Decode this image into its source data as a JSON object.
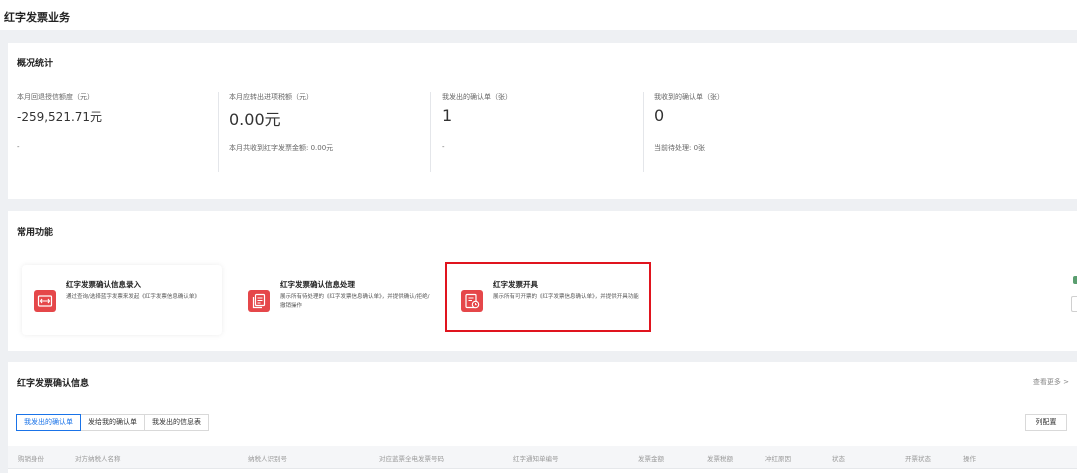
{
  "page": {
    "title": "红字发票业务"
  },
  "overview": {
    "title": "概况统计",
    "stats": [
      {
        "label": "本月回退授信额度（元）",
        "value": "-259,521.71元",
        "sub": "-"
      },
      {
        "label": "本月应转出进项税额（元）",
        "value": "0.00元",
        "sub": "本月共收到红字发票金额:  0.00元"
      },
      {
        "label": "我发出的确认单（张）",
        "value": "1",
        "sub": "-"
      },
      {
        "label": "我收到的确认单（张）",
        "value": "0",
        "sub": "当前待处理:  0张"
      }
    ]
  },
  "functions": {
    "title": "常用功能",
    "tiles": [
      {
        "title": "红字发票确认信息录入",
        "desc": "通过查询/选择蓝字发票来发起《红字发票信息确认单》",
        "icon": "exchange-icon"
      },
      {
        "title": "红字发票确认信息处理",
        "desc": "展示所有待处理的《红字发票信息确认单》，并提供确认/拒绝/撤销操作",
        "icon": "document-stack-icon"
      },
      {
        "title": "红字发票开具",
        "desc": "展示所有可开票的《红字发票信息确认单》，并提供开具功能",
        "icon": "invoice-clock-icon"
      }
    ]
  },
  "confirm": {
    "title": "红字发票确认信息",
    "more": "查看更多 >",
    "tabs": [
      "我发出的确认单",
      "发给我的确认单",
      "我发出的信息表"
    ],
    "active_tab": 0,
    "config_button": "列配置",
    "columns": [
      "购销身份",
      "对方纳税人名称",
      "纳税人识别号",
      "对应蓝票全电发票号码",
      "红字通知单编号",
      "发票金额",
      "发票税额",
      "冲红原因",
      "状态",
      "开票状态",
      "操作"
    ]
  },
  "colors": {
    "accent": "#1a73e8",
    "icon_red": "#e5474a",
    "highlight": "#e0141e"
  }
}
